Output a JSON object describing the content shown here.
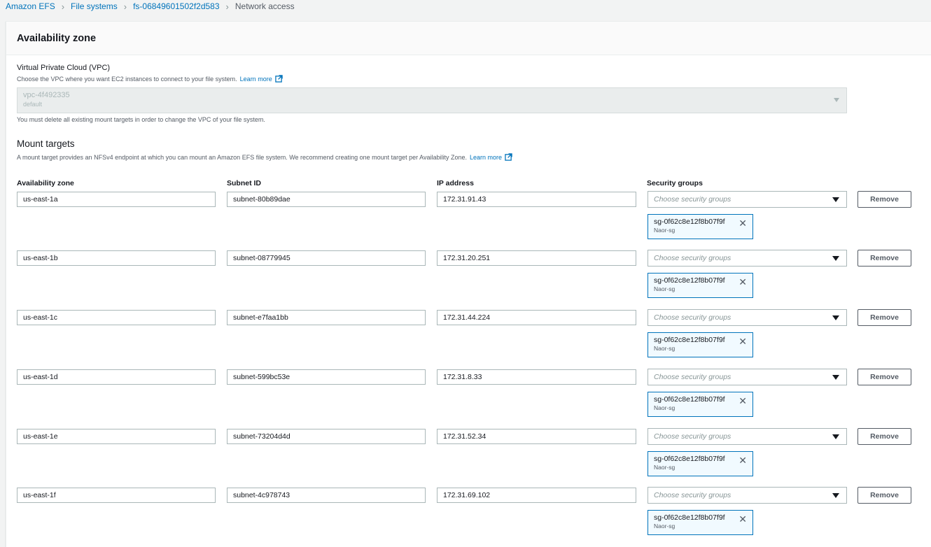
{
  "breadcrumb": {
    "items": [
      "Amazon EFS",
      "File systems",
      "fs-06849601502f2d583"
    ],
    "current": "Network access"
  },
  "panel": {
    "title": "Availability zone"
  },
  "vpc": {
    "label": "Virtual Private Cloud (VPC)",
    "description": "Choose the VPC where you want EC2 instances to connect to your file system.",
    "learn_more": "Learn more",
    "value": "vpc-4f492335",
    "sub": "default",
    "note": "You must delete all existing mount targets in order to change the VPC of your file system."
  },
  "mount_targets": {
    "title": "Mount targets",
    "description": "A mount target provides an NFSv4 endpoint at which you can mount an Amazon EFS file system. We recommend creating one mount target per Availability Zone.",
    "learn_more": "Learn more",
    "columns": {
      "az": "Availability zone",
      "subnet": "Subnet ID",
      "ip": "IP address",
      "sg": "Security groups"
    },
    "sg_placeholder": "Choose security groups",
    "remove_label": "Remove",
    "rows": [
      {
        "az": "us-east-1a",
        "subnet": "subnet-80b89dae",
        "ip": "172.31.91.43",
        "sg_id": "sg-0f62c8e12f8b07f9f",
        "sg_name": "Naor-sg"
      },
      {
        "az": "us-east-1b",
        "subnet": "subnet-08779945",
        "ip": "172.31.20.251",
        "sg_id": "sg-0f62c8e12f8b07f9f",
        "sg_name": "Naor-sg"
      },
      {
        "az": "us-east-1c",
        "subnet": "subnet-e7faa1bb",
        "ip": "172.31.44.224",
        "sg_id": "sg-0f62c8e12f8b07f9f",
        "sg_name": "Naor-sg"
      },
      {
        "az": "us-east-1d",
        "subnet": "subnet-599bc53e",
        "ip": "172.31.8.33",
        "sg_id": "sg-0f62c8e12f8b07f9f",
        "sg_name": "Naor-sg"
      },
      {
        "az": "us-east-1e",
        "subnet": "subnet-73204d4d",
        "ip": "172.31.52.34",
        "sg_id": "sg-0f62c8e12f8b07f9f",
        "sg_name": "Naor-sg"
      },
      {
        "az": "us-east-1f",
        "subnet": "subnet-4c978743",
        "ip": "172.31.69.102",
        "sg_id": "sg-0f62c8e12f8b07f9f",
        "sg_name": "Naor-sg"
      }
    ]
  },
  "colors": {
    "link": "#0073bb",
    "token_bg": "#f1faff",
    "token_border": "#0073bb",
    "header_bg": "#fafafa",
    "page_bg": "#f2f3f3"
  }
}
